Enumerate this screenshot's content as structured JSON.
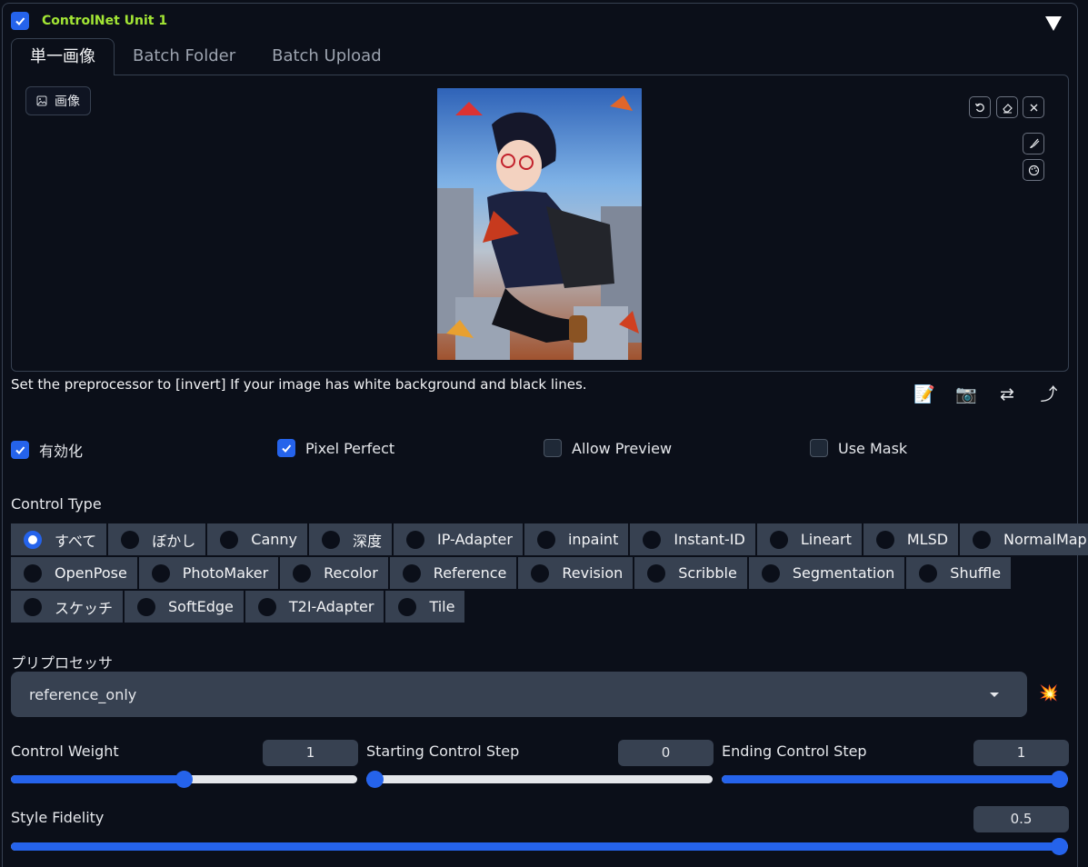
{
  "unit": {
    "title": "ControlNet Unit 1",
    "enabled": true
  },
  "tabs": [
    {
      "label": "単一画像",
      "active": true
    },
    {
      "label": "Batch Folder",
      "active": false
    },
    {
      "label": "Batch Upload",
      "active": false
    }
  ],
  "image_panel": {
    "label": "画像"
  },
  "hint": "Set the preprocessor to [invert] If your image has white background and black lines.",
  "tool_icons": [
    "memo-icon",
    "camera-icon",
    "swap-icon",
    "send-dimensions-icon"
  ],
  "options": [
    {
      "label": "有効化",
      "checked": true
    },
    {
      "label": "Pixel Perfect",
      "checked": true
    },
    {
      "label": "Allow Preview",
      "checked": false
    },
    {
      "label": "Use Mask",
      "checked": false
    }
  ],
  "control_type": {
    "label": "Control Type",
    "rows": [
      [
        "すべて",
        "ぼかし",
        "Canny",
        "深度",
        "IP-Adapter",
        "inpaint",
        "Instant-ID",
        "Lineart",
        "MLSD",
        "NormalMap"
      ],
      [
        "OpenPose",
        "PhotoMaker",
        "Recolor",
        "Reference",
        "Revision",
        "Scribble",
        "Segmentation",
        "Shuffle"
      ],
      [
        "スケッチ",
        "SoftEdge",
        "T2I-Adapter",
        "Tile"
      ]
    ],
    "selected": "すべて"
  },
  "preprocessor": {
    "label": "プリプロセッサ",
    "value": "reference_only"
  },
  "sliders": {
    "control_weight": {
      "label": "Control Weight",
      "value": "1",
      "fill_fraction": 0.5
    },
    "starting_step": {
      "label": "Starting Control Step",
      "value": "0",
      "fill_fraction": 0.0
    },
    "ending_step": {
      "label": "Ending Control Step",
      "value": "1",
      "fill_fraction": 1.0
    },
    "style_fidelity": {
      "label": "Style Fidelity",
      "value": "0.5",
      "fill_fraction": 1.0
    }
  },
  "colors": {
    "accent": "#2563eb",
    "header": "#a3e635",
    "background": "#0b0f19",
    "control": "#374151"
  }
}
